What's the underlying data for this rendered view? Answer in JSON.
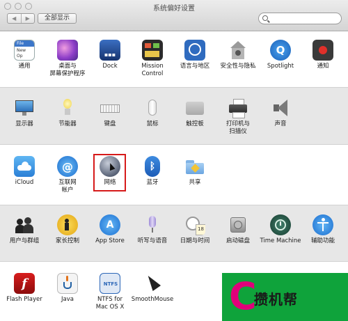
{
  "window": {
    "title": "系统偏好设置",
    "show_all": "全部显示",
    "nav_back": "◀",
    "nav_forward": "▶",
    "search_placeholder": ""
  },
  "sections": [
    [
      {
        "id": "general",
        "label": "通用"
      },
      {
        "id": "desktop",
        "label": "桌面与\n屏幕保护程序"
      },
      {
        "id": "dock",
        "label": "Dock"
      },
      {
        "id": "mission-control",
        "label": "Mission\nControl"
      },
      {
        "id": "language",
        "label": "语言与地区"
      },
      {
        "id": "security",
        "label": "安全性与隐私"
      },
      {
        "id": "spotlight",
        "label": "Spotlight"
      },
      {
        "id": "notifications",
        "label": "通知"
      }
    ],
    [
      {
        "id": "displays",
        "label": "显示器"
      },
      {
        "id": "energy",
        "label": "节能器"
      },
      {
        "id": "keyboard",
        "label": "键盘"
      },
      {
        "id": "mouse",
        "label": "鼠标"
      },
      {
        "id": "trackpad",
        "label": "触控板"
      },
      {
        "id": "printers",
        "label": "打印机与\n扫描仪"
      },
      {
        "id": "sound",
        "label": "声音"
      }
    ],
    [
      {
        "id": "icloud",
        "label": "iCloud"
      },
      {
        "id": "internet-accounts",
        "label": "互联网\n帐户"
      },
      {
        "id": "network",
        "label": "网络"
      },
      {
        "id": "bluetooth",
        "label": "蓝牙"
      },
      {
        "id": "sharing",
        "label": "共享"
      }
    ],
    [
      {
        "id": "users",
        "label": "用户与群组"
      },
      {
        "id": "parental",
        "label": "家长控制"
      },
      {
        "id": "app-store",
        "label": "App Store"
      },
      {
        "id": "dictation",
        "label": "听写与语音"
      },
      {
        "id": "date-time",
        "label": "日期与时间"
      },
      {
        "id": "startup-disk",
        "label": "启动磁盘"
      },
      {
        "id": "time-machine",
        "label": "Time Machine"
      },
      {
        "id": "accessibility",
        "label": "辅助功能"
      }
    ],
    [
      {
        "id": "flash",
        "label": "Flash Player"
      },
      {
        "id": "java",
        "label": "Java"
      },
      {
        "id": "ntfs",
        "label": "NTFS for\nMac OS X"
      },
      {
        "id": "smoothmouse",
        "label": "SmoothMouse"
      }
    ]
  ],
  "icon_text": {
    "general_file": "File",
    "general_new": "New",
    "general_op": "Op",
    "calendar_day": "18",
    "ntfs": "NTFS",
    "dock_glyph": "▪▪▪",
    "spotlight_glyph": "Q"
  },
  "watermark": {
    "letter": "C",
    "text": "攒机帮"
  },
  "colors": {
    "highlight": "#d61a1a",
    "watermark_bg": "#0fa33b",
    "watermark_letter": "#e0007a"
  }
}
